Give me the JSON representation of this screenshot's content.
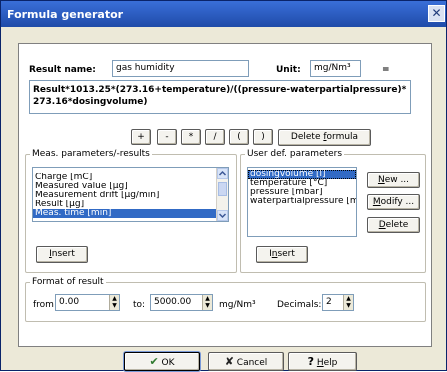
{
  "window": {
    "title": "Formula generator",
    "close_glyph": "✕"
  },
  "result": {
    "name_label": "Result name:",
    "name_value": "gas humidity",
    "unit_label": "Unit:",
    "unit_value": "mg/Nm³",
    "equals": "=",
    "formula": "Result*1013.25*(273.16+temperature)/((pressure-waterpartialpressure)*273.16*dosingvolume)"
  },
  "operators": [
    "+",
    "-",
    "*",
    "/",
    "(",
    ")"
  ],
  "delete_formula": {
    "pre": "Delete ",
    "key": "f",
    "post": "ormula"
  },
  "meas": {
    "legend": "Meas. parameters/-results",
    "items": [
      "Charge [mC]",
      "Measured value [µg]",
      "Measurement drift [µg/min]",
      "Result [µg]",
      "Meas. time [min]"
    ],
    "selected_index": 4,
    "insert": {
      "key": "I",
      "post": "nsert"
    }
  },
  "user": {
    "legend": "User def. parameters",
    "items": [
      "dosingvolume [l]",
      "temperature [°C]",
      "pressure [mbar]",
      "waterpartialpressure [mbar"
    ],
    "selected_index": 0,
    "insert": {
      "pre": "I",
      "key": "n",
      "post": "sert"
    },
    "new": {
      "key": "N",
      "post": "ew ..."
    },
    "modify": {
      "key": "M",
      "post": "odify ..."
    },
    "delete": {
      "key": "D",
      "post": "elete"
    }
  },
  "format": {
    "legend": "Format of result",
    "from_label": "from:",
    "from_value": "0.00",
    "to_label": "to:",
    "to_value": "5000.00",
    "unit": "mg/Nm³",
    "decimals_label": "Decimals:",
    "decimals_value": "2"
  },
  "buttons": {
    "ok": "OK",
    "cancel": "Cancel",
    "help": {
      "key": "H",
      "post": "elp"
    }
  },
  "icons": {
    "check": "✔",
    "cross": "✘",
    "question": "?"
  }
}
